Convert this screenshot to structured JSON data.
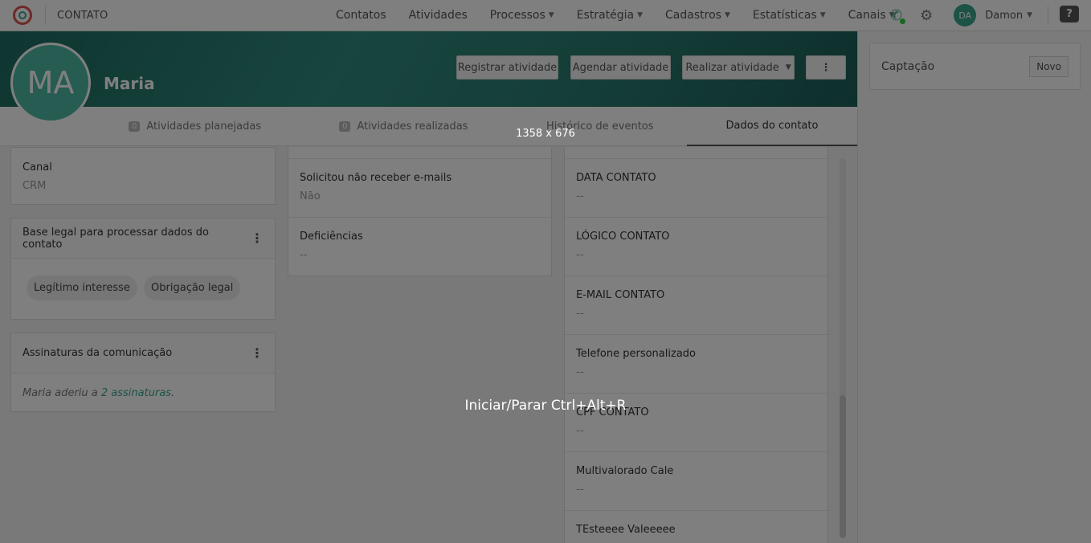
{
  "topbar": {
    "app_title": "CONTATO",
    "nav": [
      {
        "label": "Contatos"
      },
      {
        "label": "Atividades"
      },
      {
        "label": "Processos"
      },
      {
        "label": "Estratégia"
      },
      {
        "label": "Cadastros"
      },
      {
        "label": "Estatísticas"
      },
      {
        "label": "Canais"
      }
    ],
    "user_initials": "DA",
    "user_name": "Damon",
    "help_icon": "question-bubble-icon"
  },
  "contact": {
    "initials": "MA",
    "name": "Maria"
  },
  "actions": {
    "register": "Registrar atividade",
    "schedule": "Agendar atividade",
    "perform": "Realizar atividade",
    "more": "⋮"
  },
  "tabs": [
    {
      "label": "Atividades planejadas",
      "count": "0"
    },
    {
      "label": "Atividades realizadas",
      "count": "0"
    },
    {
      "label": "Histórico de eventos"
    },
    {
      "label": "Dados do contato"
    }
  ],
  "left_column": {
    "canal": {
      "label": "Canal",
      "value": "CRM"
    },
    "legal_basis": {
      "title": "Base legal para processar dados do contato",
      "chips": [
        "Legítimo interesse",
        "Obrigação legal"
      ]
    },
    "subscriptions": {
      "title": "Assinaturas da comunicação",
      "text_prefix": "Maria aderiu a ",
      "link": "2 assinaturas",
      "text_suffix": "."
    }
  },
  "middle_column": [
    {
      "label": "Solicitou não receber e-mails",
      "value": "Não"
    },
    {
      "label": "Deficiências",
      "value": "--"
    }
  ],
  "right_column": [
    {
      "label": "DATA CONTATO",
      "value": "--"
    },
    {
      "label": "LÓGICO CONTATO",
      "value": "--"
    },
    {
      "label": "E-MAIL CONTATO",
      "value": "--"
    },
    {
      "label": "Telefone personalizado",
      "value": "--"
    },
    {
      "label": "CPF CONTATO",
      "value": "--"
    },
    {
      "label": "Multivalorado Cale",
      "value": "--"
    },
    {
      "label": "TEsteeee Valeeeee",
      "value": ""
    }
  ],
  "side_panel": {
    "title": "Captação",
    "new_button": "Novo"
  },
  "overlay": {
    "dimensions": "1358 x 676",
    "record_hint": "Iniciar/Parar Ctrl+Alt+R"
  }
}
